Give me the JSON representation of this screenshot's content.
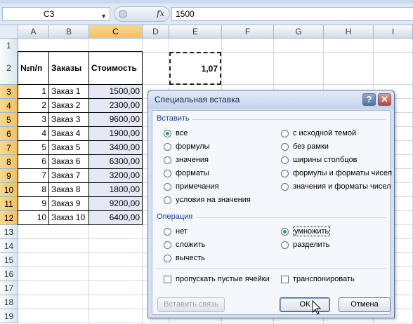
{
  "formula_bar": {
    "name_box": "C3",
    "fx_label": "fx",
    "value": "1500"
  },
  "columns": [
    "A",
    "B",
    "C",
    "D",
    "E",
    "F",
    "G",
    "H",
    "I"
  ],
  "rows": [
    "1",
    "2",
    "3",
    "4",
    "5",
    "6",
    "7",
    "8",
    "9",
    "10",
    "11",
    "12",
    "13",
    "14",
    "15",
    "16",
    "17",
    "18",
    "19"
  ],
  "table": {
    "headers": [
      "№п/п",
      "Заказы",
      "Стоимость"
    ],
    "rows": [
      {
        "n": "1",
        "order": "Заказ 1",
        "cost": "1500,00"
      },
      {
        "n": "2",
        "order": "Заказ 2",
        "cost": "2300,00"
      },
      {
        "n": "3",
        "order": "Заказ 3",
        "cost": "9600,00"
      },
      {
        "n": "4",
        "order": "Заказ 4",
        "cost": "1900,00"
      },
      {
        "n": "5",
        "order": "Заказ 5",
        "cost": "3400,00"
      },
      {
        "n": "6",
        "order": "Заказ 6",
        "cost": "6300,00"
      },
      {
        "n": "7",
        "order": "Заказ 7",
        "cost": "3200,00"
      },
      {
        "n": "8",
        "order": "Заказ 8",
        "cost": "1800,00"
      },
      {
        "n": "9",
        "order": "Заказ 9",
        "cost": "9200,00"
      },
      {
        "n": "10",
        "order": "Заказ 10",
        "cost": "6400,00"
      }
    ]
  },
  "e2_value": "1,07",
  "dialog": {
    "title": "Специальная вставка",
    "help_glyph": "?",
    "close_glyph": "✕",
    "paste_group": "Вставить",
    "paste_left": [
      {
        "label": "все",
        "selected": true
      },
      {
        "label": "формулы",
        "selected": false
      },
      {
        "label": "значения",
        "selected": false
      },
      {
        "label": "форматы",
        "selected": false
      },
      {
        "label": "примечания",
        "selected": false
      },
      {
        "label": "условия на значения",
        "selected": false
      }
    ],
    "paste_right": [
      {
        "label": "с исходной темой",
        "selected": false
      },
      {
        "label": "без рамки",
        "selected": false
      },
      {
        "label": "ширины столбцов",
        "selected": false
      },
      {
        "label": "формулы и форматы чисел",
        "selected": false
      },
      {
        "label": "значения и форматы чисел",
        "selected": false
      }
    ],
    "operation_group": "Операция",
    "op_left": [
      {
        "label": "нет",
        "selected": false
      },
      {
        "label": "сложить",
        "selected": false
      },
      {
        "label": "вычесть",
        "selected": false
      }
    ],
    "op_right": [
      {
        "label": "умножить",
        "selected": true
      },
      {
        "label": "разделить",
        "selected": false
      }
    ],
    "skip_blanks": "пропускать пустые ячейки",
    "transpose": "транспонировать",
    "paste_link": "Вставить связь",
    "ok": "ОК",
    "cancel": "Отмена"
  }
}
